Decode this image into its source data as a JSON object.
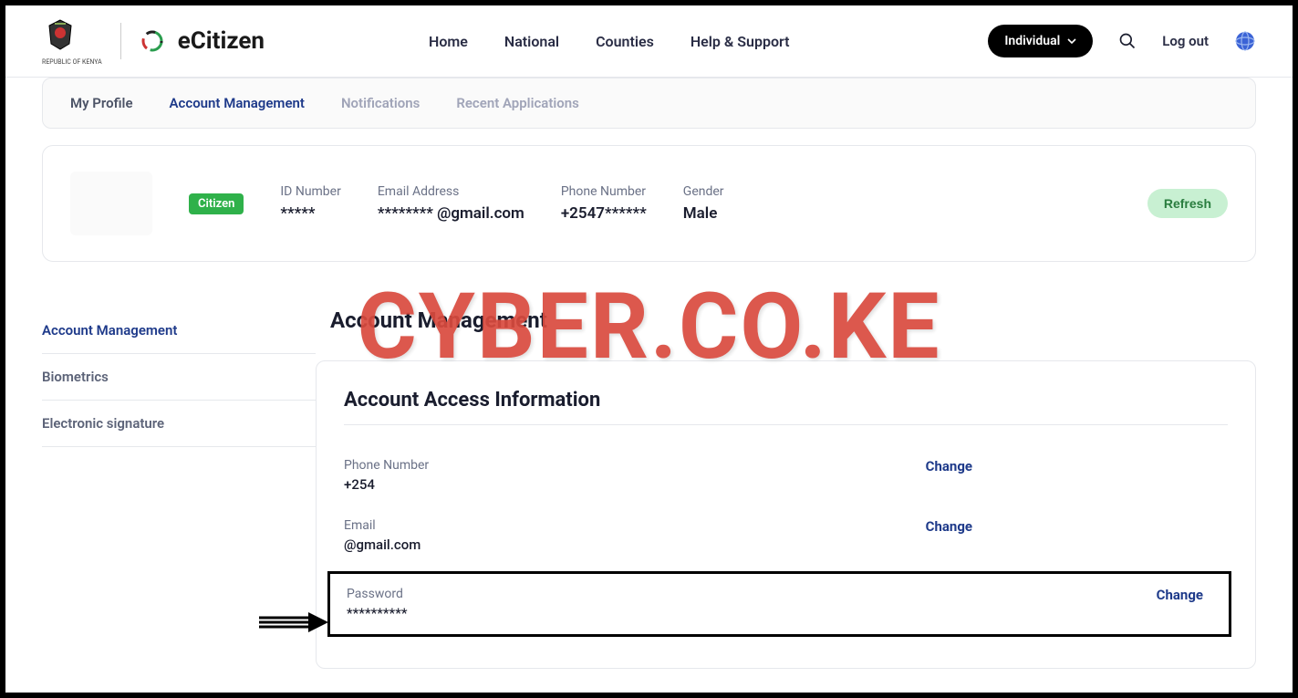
{
  "header": {
    "brand": "eCitizen",
    "brand_subtitle": "REPUBLIC OF KENYA",
    "nav": {
      "home": "Home",
      "national": "National",
      "counties": "Counties",
      "help": "Help & Support"
    },
    "account_pill": "Individual",
    "logout": "Log out"
  },
  "tabs": {
    "my_profile": "My Profile",
    "account_mgmt": "Account Management",
    "notifications": "Notifications",
    "recent_apps": "Recent Applications"
  },
  "profile": {
    "badge": "Citizen",
    "id_label": "ID Number",
    "id_value": "*****",
    "email_label": "Email Address",
    "email_value": "********       @gmail.com",
    "phone_label": "Phone Number",
    "phone_value": "+2547******",
    "gender_label": "Gender",
    "gender_value": "Male",
    "refresh": "Refresh"
  },
  "sidenav": {
    "acct": "Account Management",
    "bio": "Biometrics",
    "esig": "Electronic signature"
  },
  "page": {
    "title": "Account Management",
    "section_title": "Account Access Information",
    "phone_label": "Phone Number",
    "phone_value": "+254",
    "email_label": "Email",
    "email_value": "                           @gmail.com",
    "password_label": "Password",
    "password_value": "**********",
    "change": "Change"
  },
  "watermark": "CYBER.CO.KE"
}
